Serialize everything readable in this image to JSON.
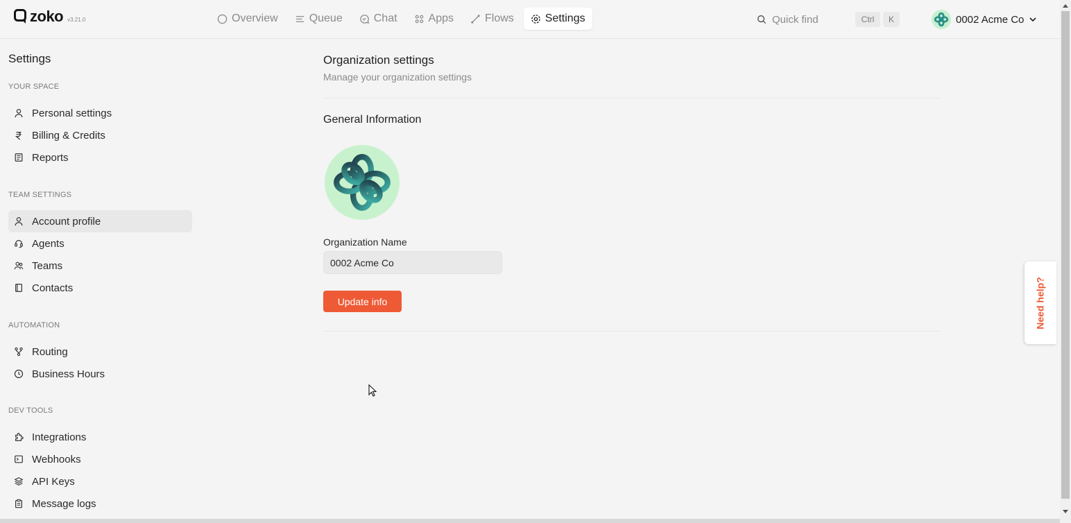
{
  "app": {
    "brand": "zoko",
    "version": "v3.21.0"
  },
  "nav": {
    "items": [
      {
        "label": "Overview",
        "icon": "circle-icon"
      },
      {
        "label": "Queue",
        "icon": "queue-icon"
      },
      {
        "label": "Chat",
        "icon": "chat-icon"
      },
      {
        "label": "Apps",
        "icon": "apps-icon"
      },
      {
        "label": "Flows",
        "icon": "flows-icon"
      },
      {
        "label": "Settings",
        "icon": "settings-icon",
        "active": true
      }
    ]
  },
  "quickfind": {
    "placeholder": "Quick find",
    "shortcut_ctrl": "Ctrl",
    "shortcut_key": "K"
  },
  "org_switcher": {
    "name": "0002 Acme Co"
  },
  "sidebar": {
    "title": "Settings",
    "sections": {
      "your_space": "YOUR SPACE",
      "team_settings": "TEAM SETTINGS",
      "automation": "AUTOMATION",
      "dev_tools": "DEV TOOLS"
    },
    "items": {
      "personal_settings": "Personal settings",
      "billing_credits": "Billing & Credits",
      "reports": "Reports",
      "account_profile": "Account profile",
      "agents": "Agents",
      "teams": "Teams",
      "contacts": "Contacts",
      "routing": "Routing",
      "business_hours": "Business Hours",
      "integrations": "Integrations",
      "webhooks": "Webhooks",
      "api_keys": "API Keys",
      "message_logs": "Message logs"
    },
    "active_item": "Account profile"
  },
  "main": {
    "title": "Organization settings",
    "subtitle": "Manage your organization settings",
    "section_title": "General Information",
    "org_name_label": "Organization Name",
    "org_name_value": "0002 Acme Co",
    "update_button": "Update info"
  },
  "help": {
    "label": "Need help?"
  },
  "colors": {
    "accent": "#ee5a35",
    "logo_bg": "#c8f2cd",
    "active_bg": "#e8e8e8"
  }
}
